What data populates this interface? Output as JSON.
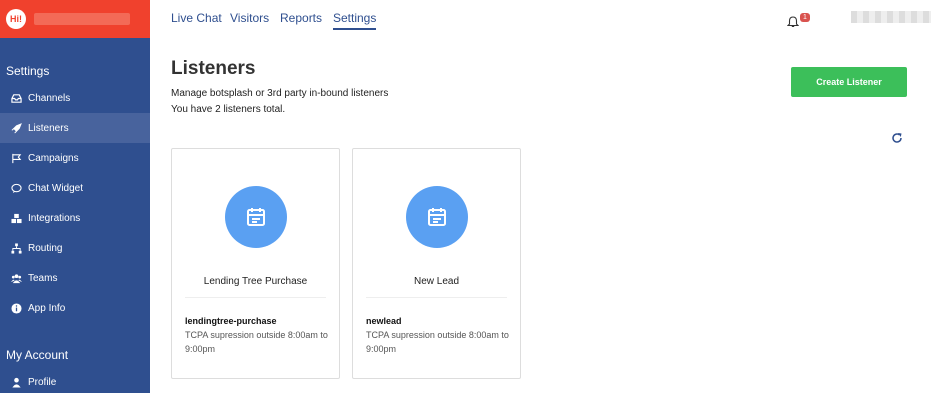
{
  "brand": {
    "logo_text": "Hi!"
  },
  "sidebar": {
    "settings_title": "Settings",
    "items": [
      {
        "label": "Channels",
        "icon": "inbox-icon"
      },
      {
        "label": "Listeners",
        "icon": "rocket-icon"
      },
      {
        "label": "Campaigns",
        "icon": "flag-icon"
      },
      {
        "label": "Chat Widget",
        "icon": "chat-icon"
      },
      {
        "label": "Integrations",
        "icon": "cubes-icon"
      },
      {
        "label": "Routing",
        "icon": "sitemap-icon"
      },
      {
        "label": "Teams",
        "icon": "users-icon"
      },
      {
        "label": "App Info",
        "icon": "info-icon"
      }
    ],
    "account_title": "My Account",
    "account_items": [
      {
        "label": "Profile",
        "icon": "user-icon"
      }
    ]
  },
  "topnav": {
    "tabs": [
      {
        "label": "Live Chat"
      },
      {
        "label": "Visitors"
      },
      {
        "label": "Reports"
      },
      {
        "label": "Settings"
      }
    ],
    "notification_count": "1"
  },
  "main": {
    "title": "Listeners",
    "subtitle": "Manage botsplash or 3rd party in-bound listeners",
    "count_text": "You have 2 listeners total.",
    "create_button": "Create Listener",
    "cards": [
      {
        "title": "Lending Tree Purchase",
        "key": "lendingtree-purchase",
        "desc": "TCPA supression outside 8:00am to 9:00pm"
      },
      {
        "title": "New Lead",
        "key": "newlead",
        "desc": "TCPA supression outside 8:00am to 9:00pm"
      }
    ]
  },
  "colors": {
    "sidebar": "#2f4f8f",
    "brand": "#f0412d",
    "accent": "#3cbf5a",
    "icon_circle": "#5aa0f2"
  }
}
